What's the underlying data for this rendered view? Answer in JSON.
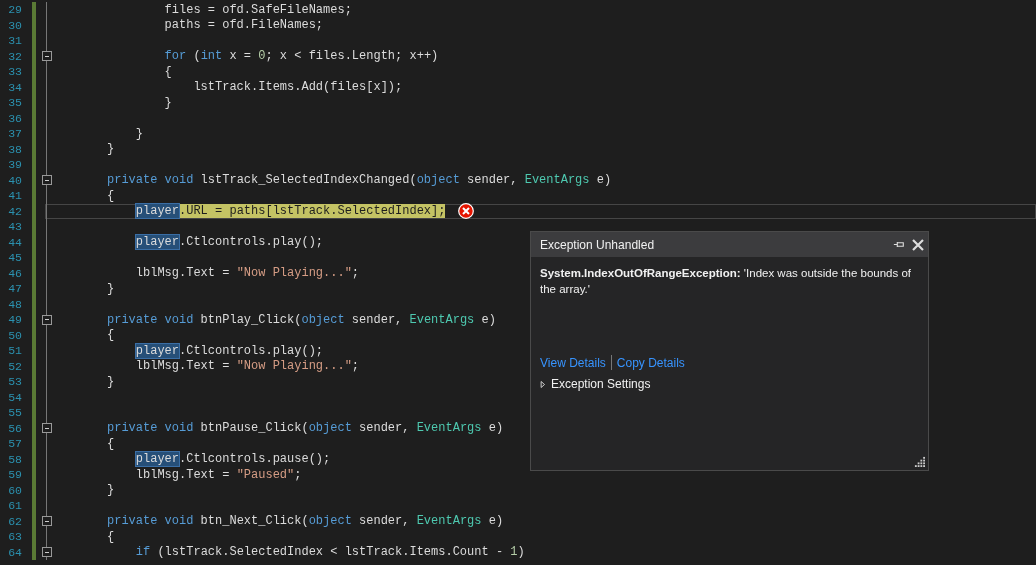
{
  "editor": {
    "lines": [
      {
        "number": "29",
        "tokens": [
          {
            "kind": "plain",
            "text": "        files = ofd.SafeFileNames;"
          }
        ]
      },
      {
        "number": "30",
        "tokens": [
          {
            "kind": "plain",
            "text": "        paths = ofd.FileNames;"
          }
        ]
      },
      {
        "number": "31"
      },
      {
        "number": "32",
        "fold": true,
        "tokens": [
          {
            "kind": "keyword",
            "text": "        for"
          },
          {
            "kind": "plain",
            "text": " ("
          },
          {
            "kind": "keyword",
            "text": "int"
          },
          {
            "kind": "plain",
            "text": " x = "
          },
          {
            "kind": "number",
            "text": "0"
          },
          {
            "kind": "plain",
            "text": "; x < files.Length; x++)"
          }
        ]
      },
      {
        "number": "33",
        "tokens": [
          {
            "kind": "plain",
            "text": "        {"
          }
        ]
      },
      {
        "number": "34",
        "tokens": [
          {
            "kind": "plain",
            "text": "            lstTrack.Items.Add(files[x]);"
          }
        ]
      },
      {
        "number": "35",
        "tokens": [
          {
            "kind": "plain",
            "text": "        }"
          }
        ]
      },
      {
        "number": "36"
      },
      {
        "number": "37",
        "tokens": [
          {
            "kind": "plain",
            "text": "    }"
          }
        ]
      },
      {
        "number": "38",
        "tokens": [
          {
            "kind": "plain",
            "text": "}"
          }
        ]
      },
      {
        "number": "39"
      },
      {
        "number": "40",
        "fold": true,
        "tokens": [
          {
            "kind": "keyword",
            "text": "private void"
          },
          {
            "kind": "plain",
            "text": " lstTrack_SelectedIndexChanged("
          },
          {
            "kind": "keyword",
            "text": "object"
          },
          {
            "kind": "plain",
            "text": " sender, "
          },
          {
            "kind": "type",
            "text": "EventArgs"
          },
          {
            "kind": "plain",
            "text": " e)"
          }
        ]
      },
      {
        "number": "41",
        "tokens": [
          {
            "kind": "plain",
            "text": "{"
          }
        ]
      },
      {
        "number": "42",
        "kind": "nested",
        "current": true,
        "error": true,
        "tokens": [
          {
            "kind": "reference",
            "text": "player"
          },
          {
            "kind": "statement",
            "text": ".URL = paths[lstTrack.SelectedIndex];"
          }
        ]
      },
      {
        "number": "43"
      },
      {
        "number": "44",
        "kind": "nested",
        "tokens": [
          {
            "kind": "reference",
            "text": "player"
          },
          {
            "kind": "plain",
            "text": ".Ctlcontrols.play();"
          }
        ]
      },
      {
        "number": "45"
      },
      {
        "number": "46",
        "tokens": [
          {
            "kind": "plain",
            "text": "    lblMsg.Text = "
          },
          {
            "kind": "string",
            "text": "\"Now Playing...\""
          },
          {
            "kind": "plain",
            "text": ";"
          }
        ]
      },
      {
        "number": "47",
        "tokens": [
          {
            "kind": "plain",
            "text": "}"
          }
        ]
      },
      {
        "number": "48"
      },
      {
        "number": "49",
        "fold": true,
        "tokens": [
          {
            "kind": "keyword",
            "text": "private void"
          },
          {
            "kind": "plain",
            "text": " btnPlay_Click("
          },
          {
            "kind": "keyword",
            "text": "object"
          },
          {
            "kind": "plain",
            "text": " sender, "
          },
          {
            "kind": "type",
            "text": "EventArgs"
          },
          {
            "kind": "plain",
            "text": " e)"
          }
        ]
      },
      {
        "number": "50",
        "tokens": [
          {
            "kind": "plain",
            "text": "{"
          }
        ]
      },
      {
        "number": "51",
        "kind": "nested",
        "tokens": [
          {
            "kind": "reference",
            "text": "player"
          },
          {
            "kind": "plain",
            "text": ".Ctlcontrols.play();"
          }
        ]
      },
      {
        "number": "52",
        "tokens": [
          {
            "kind": "plain",
            "text": "    lblMsg.Text = "
          },
          {
            "kind": "string",
            "text": "\"Now Playing...\""
          },
          {
            "kind": "plain",
            "text": ";"
          }
        ]
      },
      {
        "number": "53",
        "tokens": [
          {
            "kind": "plain",
            "text": "}"
          }
        ]
      },
      {
        "number": "54"
      },
      {
        "number": "55"
      },
      {
        "number": "56",
        "fold": true,
        "tokens": [
          {
            "kind": "keyword",
            "text": "private void"
          },
          {
            "kind": "plain",
            "text": " btnPause_Click("
          },
          {
            "kind": "keyword",
            "text": "object"
          },
          {
            "kind": "plain",
            "text": " sender, "
          },
          {
            "kind": "type",
            "text": "EventArgs"
          },
          {
            "kind": "plain",
            "text": " e)"
          }
        ]
      },
      {
        "number": "57",
        "tokens": [
          {
            "kind": "plain",
            "text": "{"
          }
        ]
      },
      {
        "number": "58",
        "kind": "nested",
        "tokens": [
          {
            "kind": "reference",
            "text": "player"
          },
          {
            "kind": "plain",
            "text": ".Ctlcontrols.pause();"
          }
        ]
      },
      {
        "number": "59",
        "tokens": [
          {
            "kind": "plain",
            "text": "    lblMsg.Text = "
          },
          {
            "kind": "string",
            "text": "\"Paused\""
          },
          {
            "kind": "plain",
            "text": ";"
          }
        ]
      },
      {
        "number": "60",
        "tokens": [
          {
            "kind": "plain",
            "text": "}"
          }
        ]
      },
      {
        "number": "61"
      },
      {
        "number": "62",
        "fold": true,
        "tokens": [
          {
            "kind": "keyword",
            "text": "private void"
          },
          {
            "kind": "plain",
            "text": " btn_Next_Click("
          },
          {
            "kind": "keyword",
            "text": "object"
          },
          {
            "kind": "plain",
            "text": " sender, "
          },
          {
            "kind": "type",
            "text": "EventArgs"
          },
          {
            "kind": "plain",
            "text": " e)"
          }
        ]
      },
      {
        "number": "63",
        "tokens": [
          {
            "kind": "plain",
            "text": "{"
          }
        ]
      },
      {
        "number": "64",
        "fold": true,
        "tokens": [
          {
            "kind": "keyword",
            "text": "    if"
          },
          {
            "kind": "plain",
            "text": " (lstTrack.SelectedIndex < lstTrack.Items.Count - "
          },
          {
            "kind": "number",
            "text": "1"
          },
          {
            "kind": "plain",
            "text": ")"
          }
        ]
      }
    ]
  },
  "exception_popup": {
    "title": "Exception Unhandled",
    "message": "**System.IndexOutOfRangeException:** 'Index was outside the bounds of the array.'",
    "links": [
      "View Details",
      "Copy Details"
    ],
    "settings": {
      "label": "Exception Settings",
      "expanded": false
    }
  }
}
